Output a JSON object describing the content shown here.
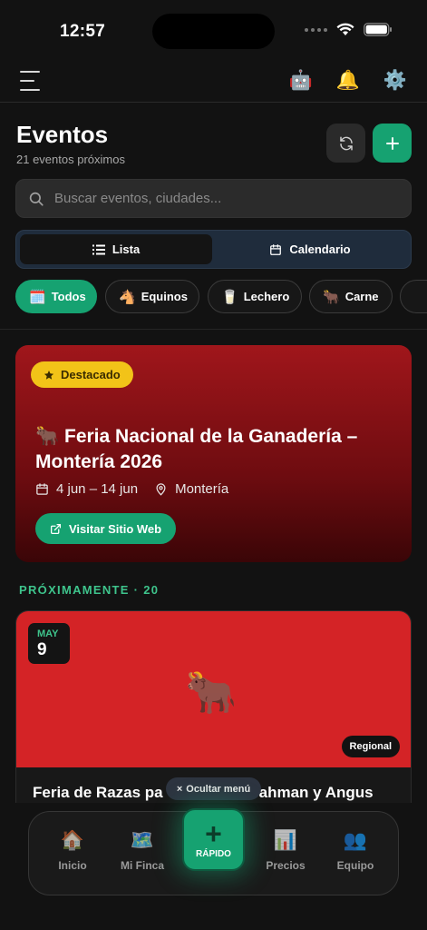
{
  "status_bar": {
    "time": "12:57"
  },
  "topbar": {
    "icons": [
      "menu-icon",
      "robot-icon",
      "bell-icon",
      "gear-icon"
    ],
    "robot": "🤖",
    "bell": "🔔",
    "gear": "⚙️"
  },
  "header": {
    "title": "Eventos",
    "subtitle": "21 eventos próximos"
  },
  "search": {
    "placeholder": "Buscar eventos, ciudades..."
  },
  "view_toggle": {
    "list_label": "Lista",
    "calendar_label": "Calendario",
    "selected": "Lista"
  },
  "chips": [
    {
      "emoji": "🗓️",
      "label": "Todos",
      "active": true
    },
    {
      "emoji": "🐴",
      "label": "Equinos",
      "active": false
    },
    {
      "emoji": "🥛",
      "label": "Lechero",
      "active": false
    },
    {
      "emoji": "🐂",
      "label": "Carne",
      "active": false
    }
  ],
  "featured": {
    "badge": "Destacado",
    "emoji": "🐂",
    "title": "Feria Nacional de la Ganadería – Montería 2026",
    "dates": "4 jun – 14 jun",
    "location": "Montería",
    "button": "Visitar Sitio Web"
  },
  "section": {
    "label": "PRÓXIMAMENTE · 20"
  },
  "event_card": {
    "month": "MAY",
    "day": "9",
    "emoji": "🐂",
    "badge": "Regional",
    "title": "Feria de Razas pa",
    "title_tail": "ahman y Angus"
  },
  "hide_menu": {
    "label": "Ocultar menú",
    "icon": "×"
  },
  "bottom_nav": {
    "items": [
      {
        "emoji": "🏠",
        "label": "Inicio"
      },
      {
        "emoji": "🗺️",
        "label": "Mi Finca"
      },
      {
        "emoji": "📊",
        "label": "Precios"
      },
      {
        "emoji": "👥",
        "label": "Equipo"
      }
    ],
    "quick": {
      "icon": "+",
      "label": "RÁPIDO"
    }
  },
  "colors": {
    "accent": "#16a271",
    "featured_red": "#a0161b",
    "badge_yellow": "#f2c318",
    "section_green": "#3ec48c"
  }
}
